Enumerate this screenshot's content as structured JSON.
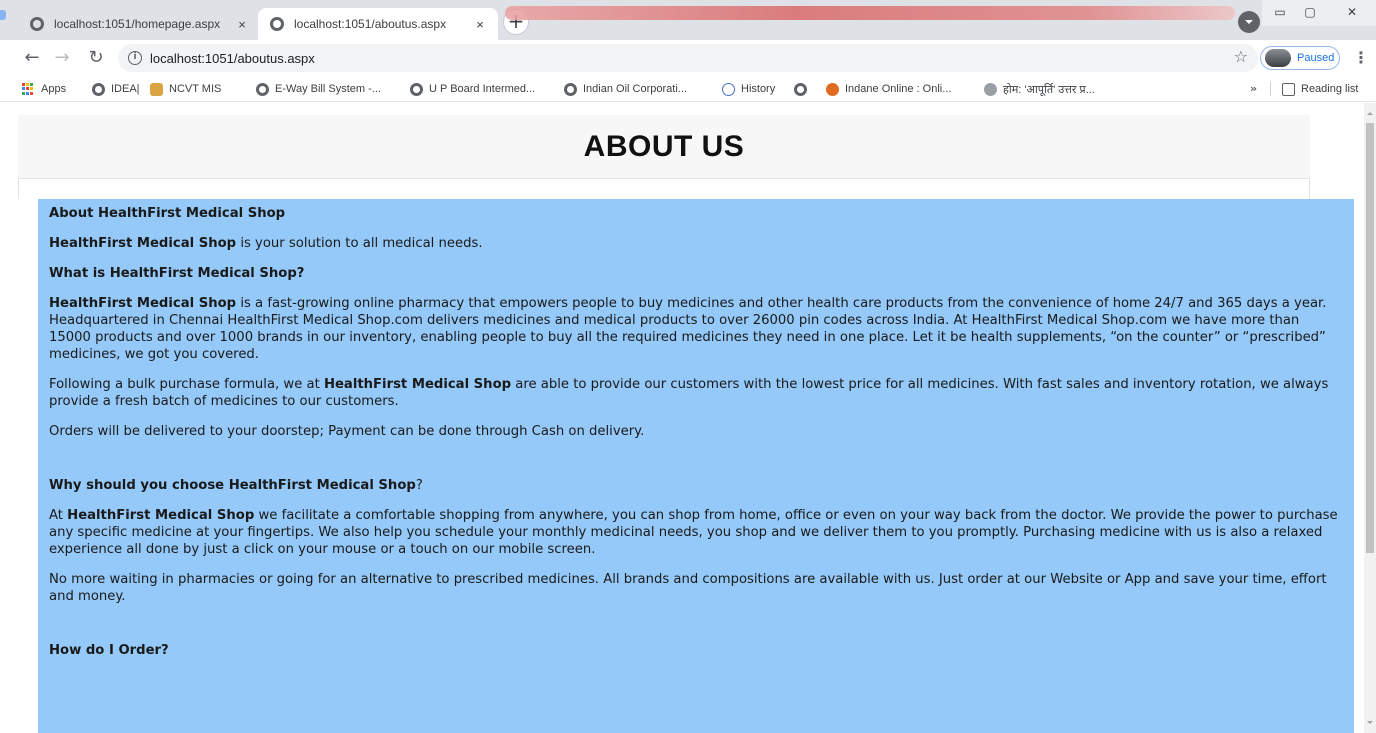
{
  "browser": {
    "tabs": [
      {
        "title": "localhost:1051/homepage.aspx",
        "active": false
      },
      {
        "title": "localhost:1051/aboutus.aspx",
        "active": true
      }
    ],
    "new_tab": "+",
    "close_glyph": "×",
    "window_controls": {
      "minimize": "▭",
      "maximize": "▢",
      "close": "✕"
    },
    "address": "localhost:1051/aboutus.aspx",
    "profile_label": "Paused",
    "bookmarks": [
      {
        "label": "Apps",
        "icon": "apps-icon"
      },
      {
        "label": "IDEA|",
        "icon": "globe-icon"
      },
      {
        "label": "NCVT MIS",
        "icon": "emblem-icon"
      },
      {
        "label": "E-Way Bill System -...",
        "icon": "globe-icon"
      },
      {
        "label": "U P Board Intermed...",
        "icon": "globe-icon"
      },
      {
        "label": "Indian Oil Corporati...",
        "icon": "globe-icon"
      },
      {
        "label": "History",
        "icon": "history-icon"
      },
      {
        "label": "",
        "icon": "globe-icon"
      },
      {
        "label": "Indane Online : Onli...",
        "icon": "lpg-icon"
      },
      {
        "label": "होम: 'आपूर्ति' उत्तर प्र...",
        "icon": "govt-icon"
      }
    ],
    "bookmarks_more": "»",
    "reading_list": "Reading list"
  },
  "page": {
    "title": "ABOUT US",
    "about_heading": "About HealthFirst Medical Shop",
    "brand": "HealthFirst Medical Shop",
    "intro_rest": " is your solution to all medical needs.",
    "what_heading": "What is HealthFirst Medical Shop?",
    "what_body_rest": " is a fast-growing online pharmacy that empowers people to buy medicines and other health care products from the convenience of home 24/7 and 365 days a year. Headquartered in Chennai HealthFirst Medical Shop.com delivers medicines and medical products to over 26000 pin codes across India.  At HealthFirst Medical Shop.com we have more than 15000 products and over 1000 brands in our inventory, enabling people to buy all the required medicines they need in one place. Let it be health supplements, “on the counter” or “prescribed” medicines, we got you covered.",
    "bulk_pre": "Following a bulk purchase formula, we at ",
    "bulk_post": " are able to provide our customers with the lowest price for all medicines. With fast sales and inventory rotation, we always provide a fresh batch of medicines to our customers.",
    "orders_text": "Orders will be delivered to your doorstep; Payment can be done through Cash on delivery.",
    "why_heading": "Why should you choose HealthFirst Medical Shop",
    "why_heading_suffix": "?",
    "why_pre": "At ",
    "why_post": " we facilitate a comfortable shopping from anywhere, you can shop from home, office or even on your way back from the doctor. We provide the power to purchase any specific medicine at your fingertips. We also help you schedule your monthly medicinal needs, you shop and we deliver them to you promptly. Purchasing medicine with us is also a relaxed experience all done by just a click on your mouse or a touch on our mobile screen.",
    "waiting_text": "No more waiting in pharmacies or going for an alternative to prescribed medicines. All brands and compositions are available with us. Just order at our Website or App and save your time, effort and money.",
    "order_heading": "How do I Order?"
  },
  "colors": {
    "content_bg": "#94c9f9",
    "header_bg": "#f7f7f7",
    "tabstrip_bg": "#dee1e6"
  }
}
